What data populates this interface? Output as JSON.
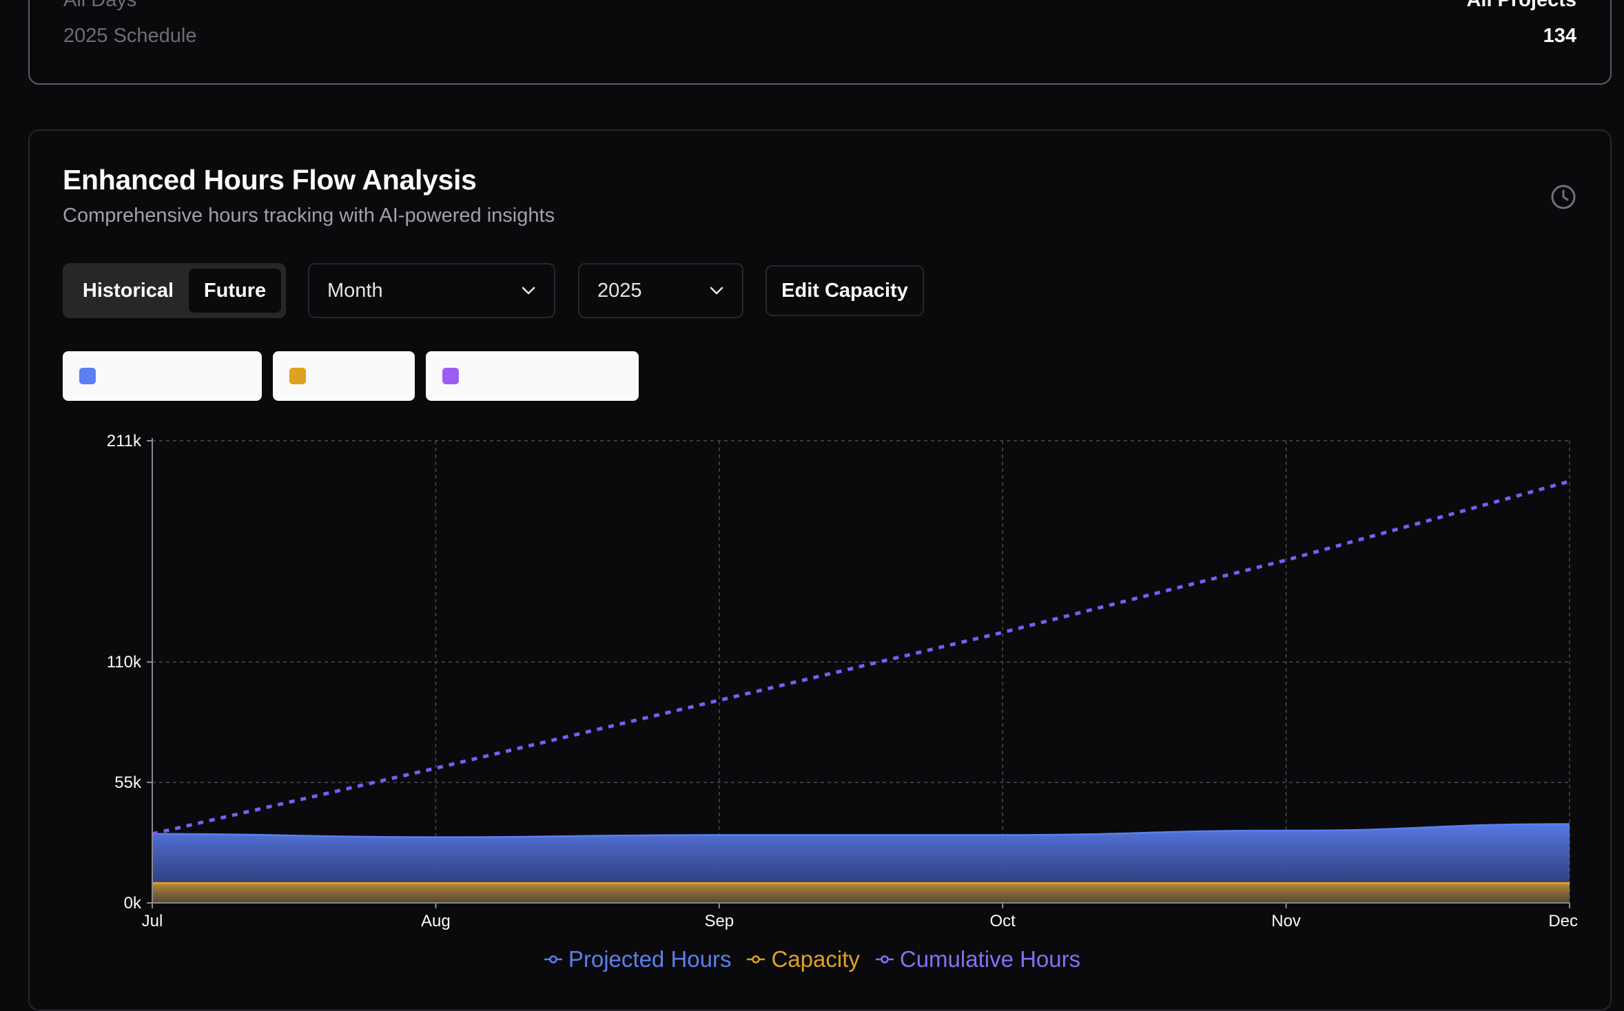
{
  "summary": {
    "row1_label": "All Days",
    "row1_value": "All Projects",
    "row2_label": "2025 Schedule",
    "row2_value": "134"
  },
  "panel": {
    "title": "Enhanced Hours Flow Analysis",
    "subtitle": "Comprehensive hours tracking with AI-powered insights",
    "icon": "clock-icon"
  },
  "controls": {
    "toggle": [
      "Historical",
      "Future"
    ],
    "toggle_active": "Future",
    "period_select": "Month",
    "year_select": "2025",
    "edit_capacity": "Edit Capacity"
  },
  "legend_chips": [
    {
      "color": "#5b7ff0",
      "label": ""
    },
    {
      "color": "#e0a021",
      "label": ""
    },
    {
      "color": "#9b5cf2",
      "label": ""
    }
  ],
  "colors": {
    "projected": "#5b7ff0",
    "capacity": "#e0a021",
    "cumulative": "#7c5cf5",
    "cumulative_legend": "#8b6cf6"
  },
  "chart_data": {
    "type": "area",
    "categories": [
      "Jul",
      "Aug",
      "Sep",
      "Oct",
      "Nov",
      "Dec"
    ],
    "y_ticks": [
      0,
      55000,
      110000,
      211000
    ],
    "y_tick_labels": [
      "0k",
      "55k",
      "110k",
      "211k"
    ],
    "ylim": [
      0,
      211000
    ],
    "grid": true,
    "legend_position": "bottom",
    "series": [
      {
        "name": "Projected Hours",
        "type": "area",
        "values": [
          31500,
          30000,
          31000,
          31000,
          33000,
          36000
        ]
      },
      {
        "name": "Capacity",
        "type": "area",
        "values": [
          9000,
          9000,
          9000,
          9000,
          9000,
          9000
        ]
      },
      {
        "name": "Cumulative Hours",
        "type": "line-dashed",
        "values": [
          31500,
          61500,
          92500,
          123500,
          156500,
          192500
        ]
      }
    ]
  }
}
